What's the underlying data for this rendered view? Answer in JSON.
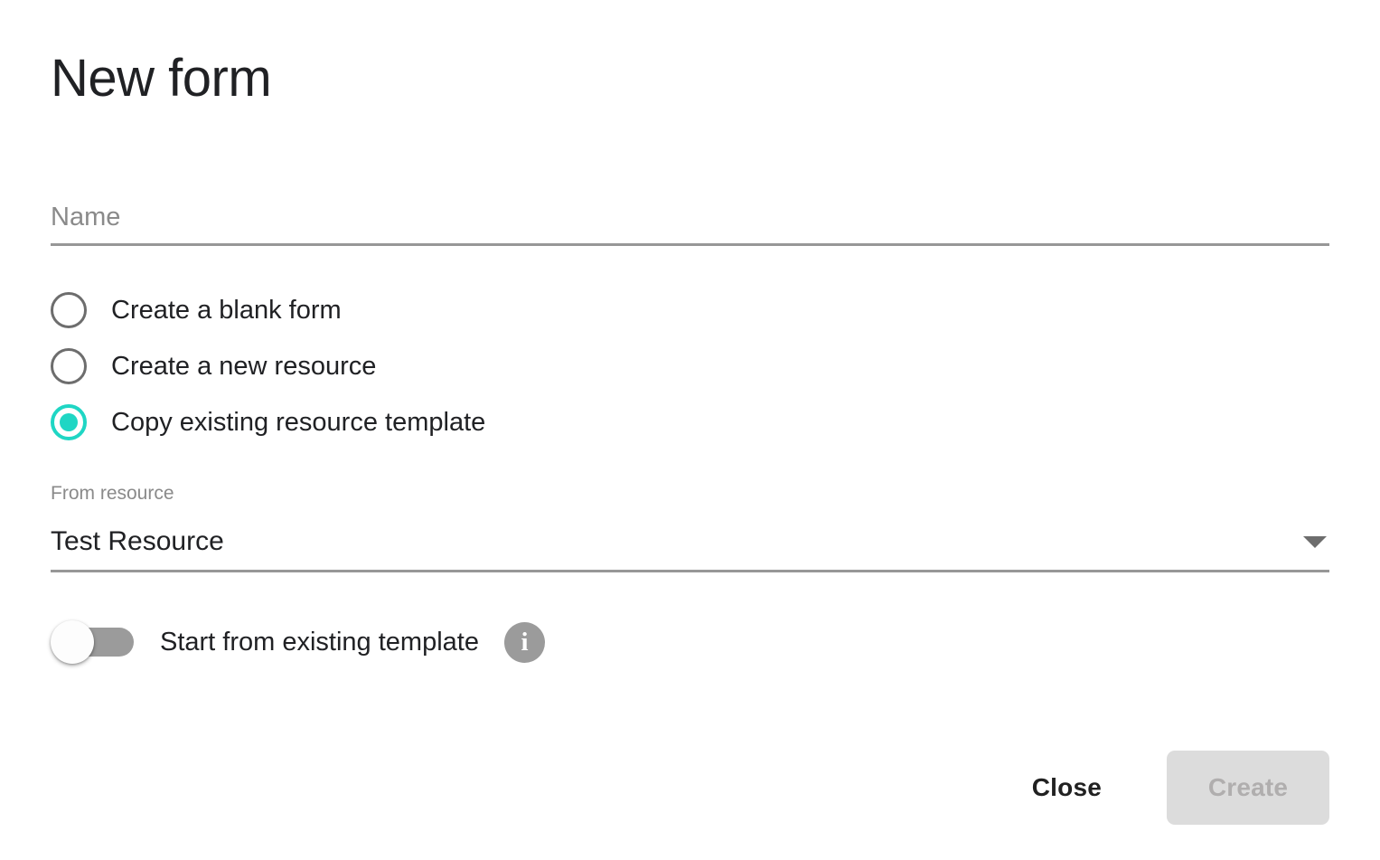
{
  "dialog": {
    "title": "New form"
  },
  "name_field": {
    "label": "Name",
    "placeholder": "Name",
    "value": ""
  },
  "creation_mode": {
    "options": [
      {
        "label": "Create a blank form",
        "selected": false
      },
      {
        "label": "Create a new resource",
        "selected": false
      },
      {
        "label": "Copy existing resource template",
        "selected": true
      }
    ]
  },
  "from_resource": {
    "caption": "From resource",
    "selected_value": "Test Resource",
    "arrow_icon": "chevron-down-icon"
  },
  "start_from_template": {
    "label": "Start from existing template",
    "state": "off",
    "info_icon": "info-icon",
    "info_glyph": "i"
  },
  "footer": {
    "close_label": "Close",
    "create_label": "Create",
    "create_disabled": true
  },
  "colors": {
    "accent": "#1FD6C4",
    "text_primary": "#202124",
    "text_muted": "#8a8a8a",
    "underline": "#979797",
    "toggle_track": "#9b9b9b",
    "disabled_bg": "#dcdcdc",
    "disabled_text": "#b0aeae"
  }
}
